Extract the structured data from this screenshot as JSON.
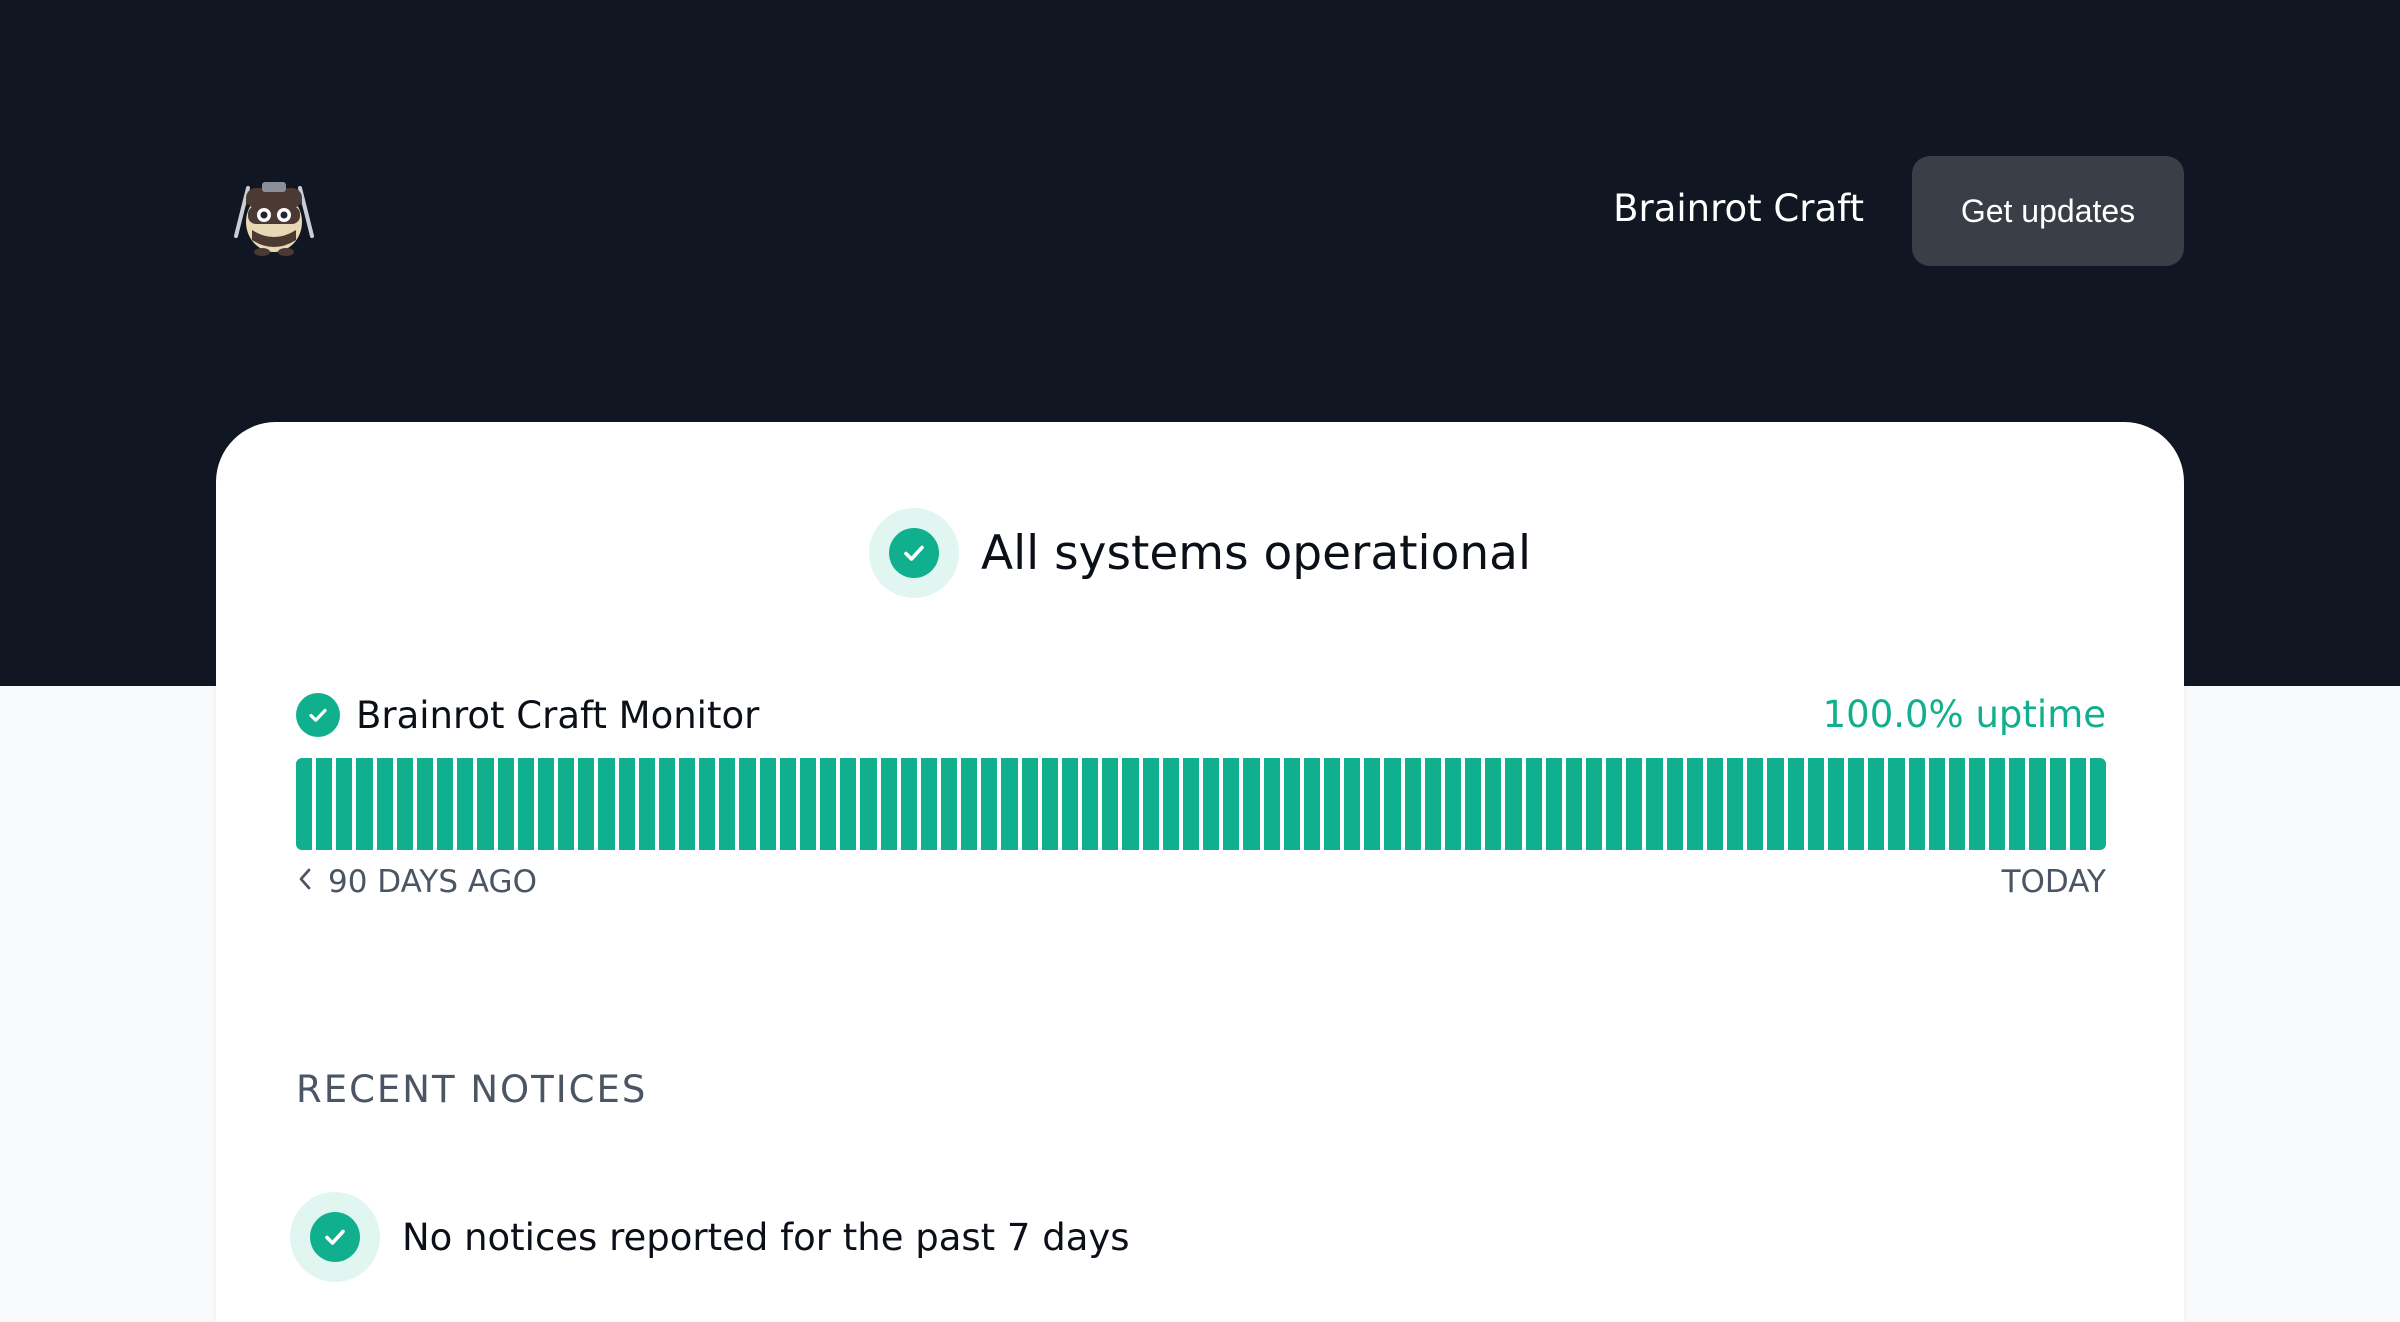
{
  "header": {
    "logo_icon": "ninja-mascot-logo",
    "brand_link": "Brainrot Craft",
    "get_updates_label": "Get updates"
  },
  "status": {
    "title": "All systems operational",
    "icon": "check-circle-icon",
    "color": "#10b08e"
  },
  "monitor": {
    "name": "Brainrot Craft Monitor",
    "uptime_text": "100.0% uptime",
    "uptime_percent": 100.0,
    "days": 90,
    "day_status": "operational",
    "range_start_label": "90 DAYS AGO",
    "range_end_label": "TODAY"
  },
  "notices": {
    "heading": "RECENT NOTICES",
    "items": [
      {
        "text": "No notices reported for the past 7 days",
        "icon": "check-circle-icon"
      }
    ]
  },
  "colors": {
    "hero_bg": "#111722",
    "accent": "#10b08e",
    "button_bg": "#3a3e46"
  }
}
